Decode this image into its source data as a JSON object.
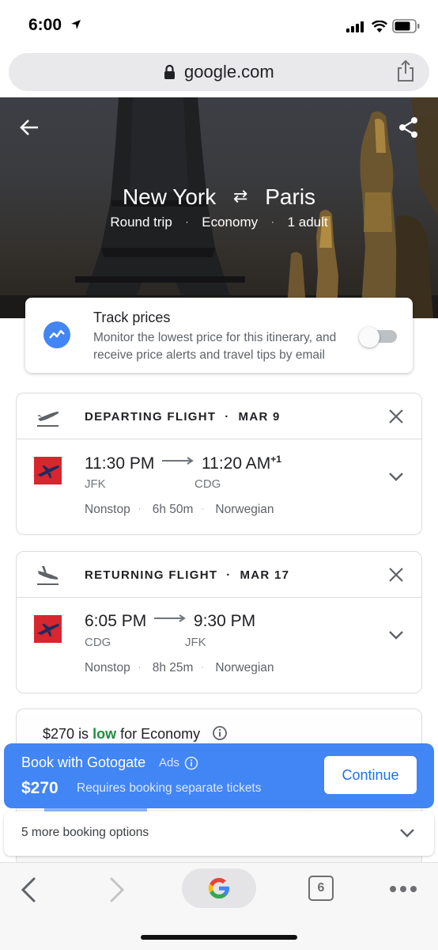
{
  "status_bar": {
    "time": "6:00"
  },
  "browser": {
    "url": "google.com"
  },
  "trip": {
    "origin": "New York",
    "destination": "Paris",
    "trip_type": "Round trip",
    "cabin": "Economy",
    "passengers": "1 adult"
  },
  "track_prices": {
    "title": "Track prices",
    "description": "Monitor the lowest price for this itinerary, and receive price alerts and travel tips by email",
    "enabled": false
  },
  "departing": {
    "label": "DEPARTING FLIGHT",
    "date": "MAR 9",
    "depart_time": "11:30 PM",
    "arrive_time": "11:20 AM",
    "day_offset": "+1",
    "depart_code": "JFK",
    "arrive_code": "CDG",
    "stops": "Nonstop",
    "duration": "6h 50m",
    "airline": "Norwegian"
  },
  "returning": {
    "label": "RETURNING FLIGHT",
    "date": "MAR 17",
    "depart_time": "6:05 PM",
    "arrive_time": "9:30 PM",
    "depart_code": "CDG",
    "arrive_code": "JFK",
    "stops": "Nonstop",
    "duration": "8h 25m",
    "airline": "Norwegian"
  },
  "price_insight": {
    "price": "$270",
    "is": "is",
    "level": "low",
    "suffix": "for Economy"
  },
  "booking": {
    "title": "Book with Gotogate",
    "ads_label": "Ads",
    "price": "$270",
    "note": "Requires booking separate tickets",
    "button": "Continue",
    "more_options": "5 more booking options"
  },
  "toolbar": {
    "tab_count": "6"
  },
  "colors": {
    "accent_blue": "#4285f4",
    "low_green": "#1e8e3e",
    "airline_red": "#d8262e"
  }
}
